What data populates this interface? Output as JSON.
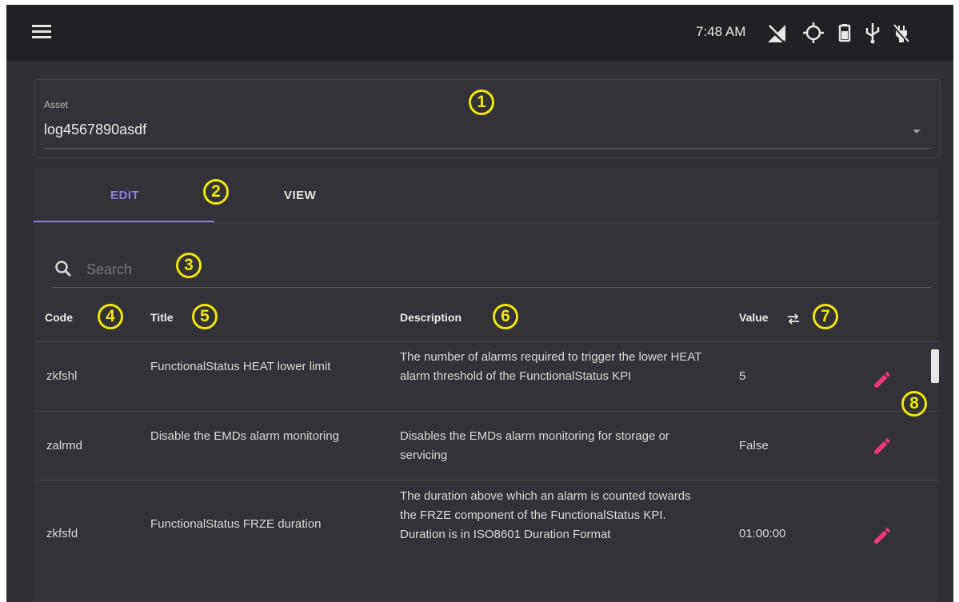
{
  "statusbar": {
    "time": "7:48 AM",
    "icons": [
      "no-signal-icon",
      "location-icon",
      "battery-icon",
      "usb-icon",
      "no-charging-icon"
    ]
  },
  "asset": {
    "label": "Asset",
    "value": "log4567890asdf"
  },
  "tabs": [
    {
      "label": "EDIT",
      "active": true
    },
    {
      "label": "VIEW",
      "active": false
    }
  ],
  "search": {
    "placeholder": "Search"
  },
  "table": {
    "headers": {
      "code": "Code",
      "title": "Title",
      "description": "Description",
      "value": "Value"
    },
    "rows": [
      {
        "code": "zkfshl",
        "title": "FunctionalStatus HEAT lower limit",
        "description": "The number of alarms required to trigger the lower HEAT alarm threshold of the FunctionalStatus KPI",
        "value": "5"
      },
      {
        "code": "zalrmd",
        "title": "Disable the EMDs alarm monitoring",
        "description": "Disables the EMDs alarm monitoring for storage or servicing",
        "value": "False"
      },
      {
        "code": "zkfsfd",
        "title": "FunctionalStatus FRZE duration",
        "description": "The duration above which an alarm is counted towards the FRZE component of the FunctionalStatus KPI. Duration is in ISO8601 Duration Format",
        "value": "01:00:00"
      }
    ]
  },
  "annotations": [
    "1",
    "2",
    "3",
    "4",
    "5",
    "6",
    "7",
    "8"
  ],
  "colors": {
    "background": "#303036",
    "statusbar": "#212125",
    "accent": "#8b7fe4",
    "edit_icon": "#f0387a",
    "annotation": "#f2e600"
  }
}
